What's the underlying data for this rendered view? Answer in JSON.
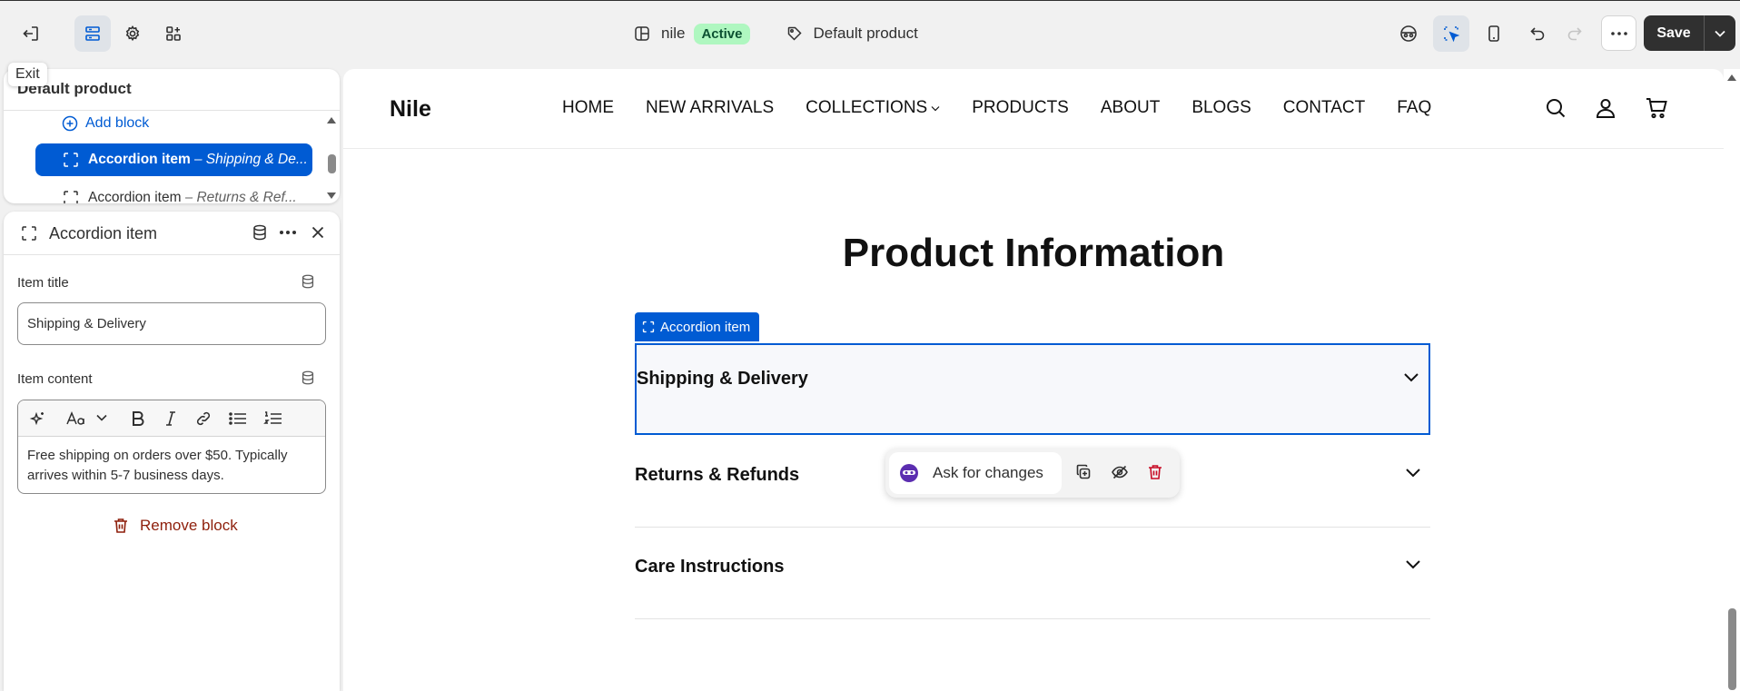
{
  "topbar": {
    "exit_tooltip": "Exit",
    "store_name": "nile",
    "status_badge": "Active",
    "template_name": "Default product",
    "save_label": "Save"
  },
  "tree": {
    "title": "Default product",
    "add_block": "Add block",
    "items": [
      {
        "label": "Accordion item",
        "sub": " – Shipping & De...",
        "selected": true
      },
      {
        "label": "Accordion item",
        "sub": " – Returns & Ref...",
        "selected": false
      }
    ]
  },
  "settings": {
    "header_title": "Accordion item",
    "item_title_label": "Item title",
    "item_title_value": "Shipping & Delivery",
    "item_content_label": "Item content",
    "item_content_value": "Free shipping on orders over $50. Typically arrives within 5-7 business days.",
    "remove_block": "Remove block"
  },
  "preview": {
    "brand": "Nile",
    "nav": [
      "HOME",
      "NEW ARRIVALS",
      "COLLECTIONS",
      "PRODUCTS",
      "ABOUT",
      "BLOGS",
      "CONTACT",
      "FAQ"
    ],
    "headline": "Product Information",
    "block_tag": "Accordion item",
    "accordion": [
      "Shipping & Delivery",
      "Returns & Refunds",
      "Care Instructions"
    ],
    "ai_prompt": "Ask for changes"
  },
  "colors": {
    "accent": "#005bd3",
    "badge_bg": "#aff7c0",
    "danger": "#8e1f0b",
    "save_bg": "#303030"
  },
  "icons": [
    "exit-icon",
    "sections-icon",
    "gear-icon",
    "apps-icon",
    "layout-icon",
    "tag-icon",
    "sidekick-icon",
    "inspector-icon",
    "mobile-icon",
    "undo-icon",
    "redo-icon",
    "more-icon",
    "chevron-down-icon",
    "plus-circle-icon",
    "block-icon",
    "database-icon",
    "close-icon",
    "magic-icon",
    "bold-icon",
    "italic-icon",
    "link-icon",
    "bullet-list-icon",
    "numbered-list-icon",
    "trash-icon",
    "search-icon",
    "user-icon",
    "cart-icon",
    "duplicate-icon",
    "hide-icon"
  ]
}
